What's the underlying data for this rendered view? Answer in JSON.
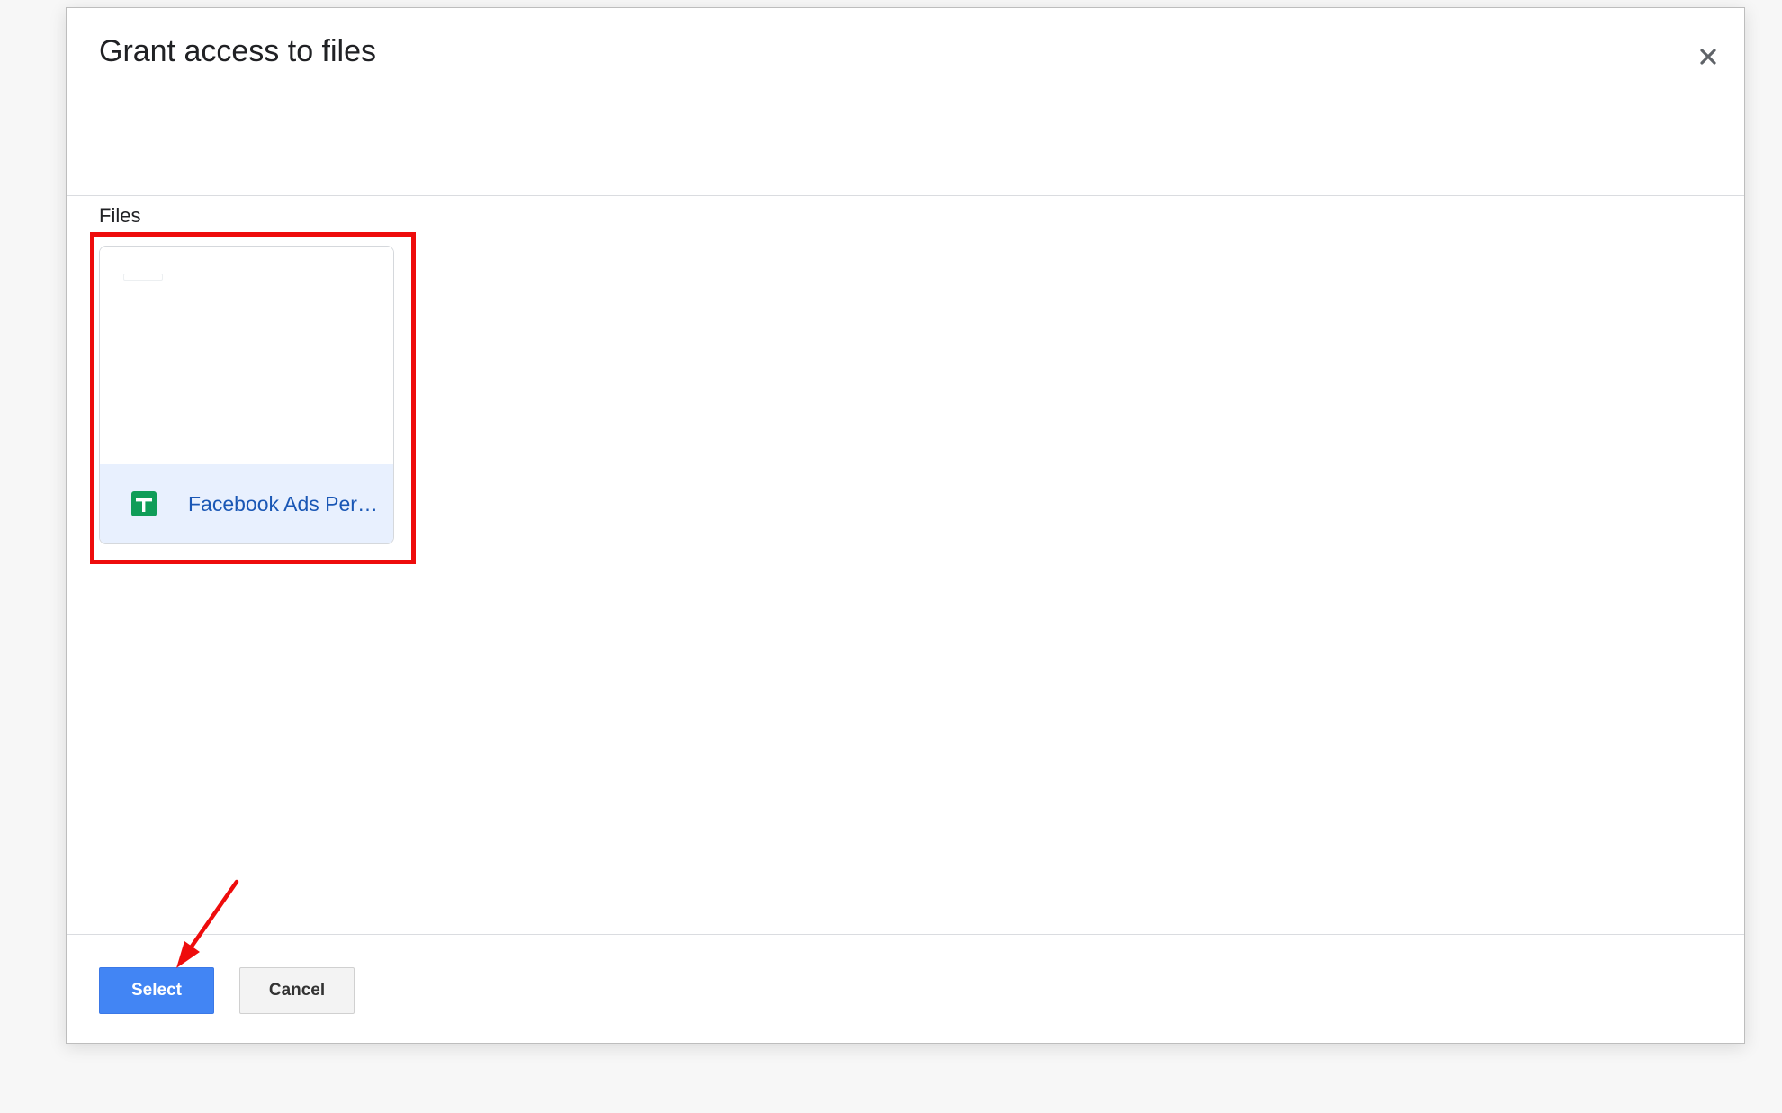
{
  "dialog": {
    "title": "Grant access to files",
    "close_icon": "close-icon"
  },
  "files_section": {
    "label": "Files",
    "items": [
      {
        "name": "Facebook Ads Per…",
        "icon": "google-sheets-icon",
        "selected": true
      }
    ]
  },
  "actions": {
    "select_label": "Select",
    "cancel_label": "Cancel"
  },
  "colors": {
    "primary_button": "#4285f4",
    "selected_file_bg": "#e8f0fe",
    "file_name_text": "#1a57b5",
    "sheets_green": "#0f9d58",
    "annotation_red": "#ee0c0c"
  },
  "annotations": {
    "highlight": "red-box-around-file-card",
    "arrow": "red-arrow-pointing-to-select-button"
  }
}
